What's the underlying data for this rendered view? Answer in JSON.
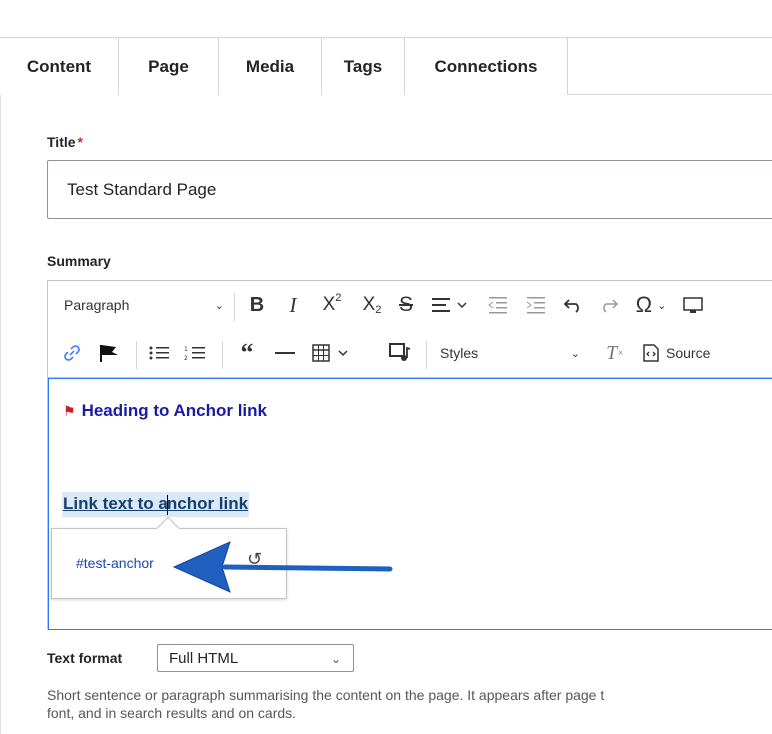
{
  "tabs": [
    {
      "label": "Content",
      "active": true
    },
    {
      "label": "Page"
    },
    {
      "label": "Media"
    },
    {
      "label": "Tags"
    },
    {
      "label": "Connections"
    }
  ],
  "title_field": {
    "label": "Title",
    "required_mark": "*",
    "value": "Test Standard Page"
  },
  "summary_field": {
    "label": "Summary",
    "toolbar": {
      "paragraph_select": "Paragraph",
      "styles_select": "Styles",
      "source_label": "Source"
    },
    "content": {
      "heading": "Heading to Anchor link",
      "link_text_before_caret": "Link text to a",
      "link_text_after_caret": "nchor link"
    },
    "link_balloon": {
      "href": "#test-anchor"
    }
  },
  "text_format": {
    "label": "Text format",
    "selected": "Full HTML"
  },
  "description": {
    "line1": "Short sentence or paragraph summarising the content on the page. It appears after page t",
    "line2": "font, and in search results and on cards."
  },
  "colors": {
    "accent_blue": "#2977ff",
    "heading_blue": "#1a1aa6",
    "annotation_arrow": "#1f5fbf",
    "required_red": "#dc2323"
  }
}
